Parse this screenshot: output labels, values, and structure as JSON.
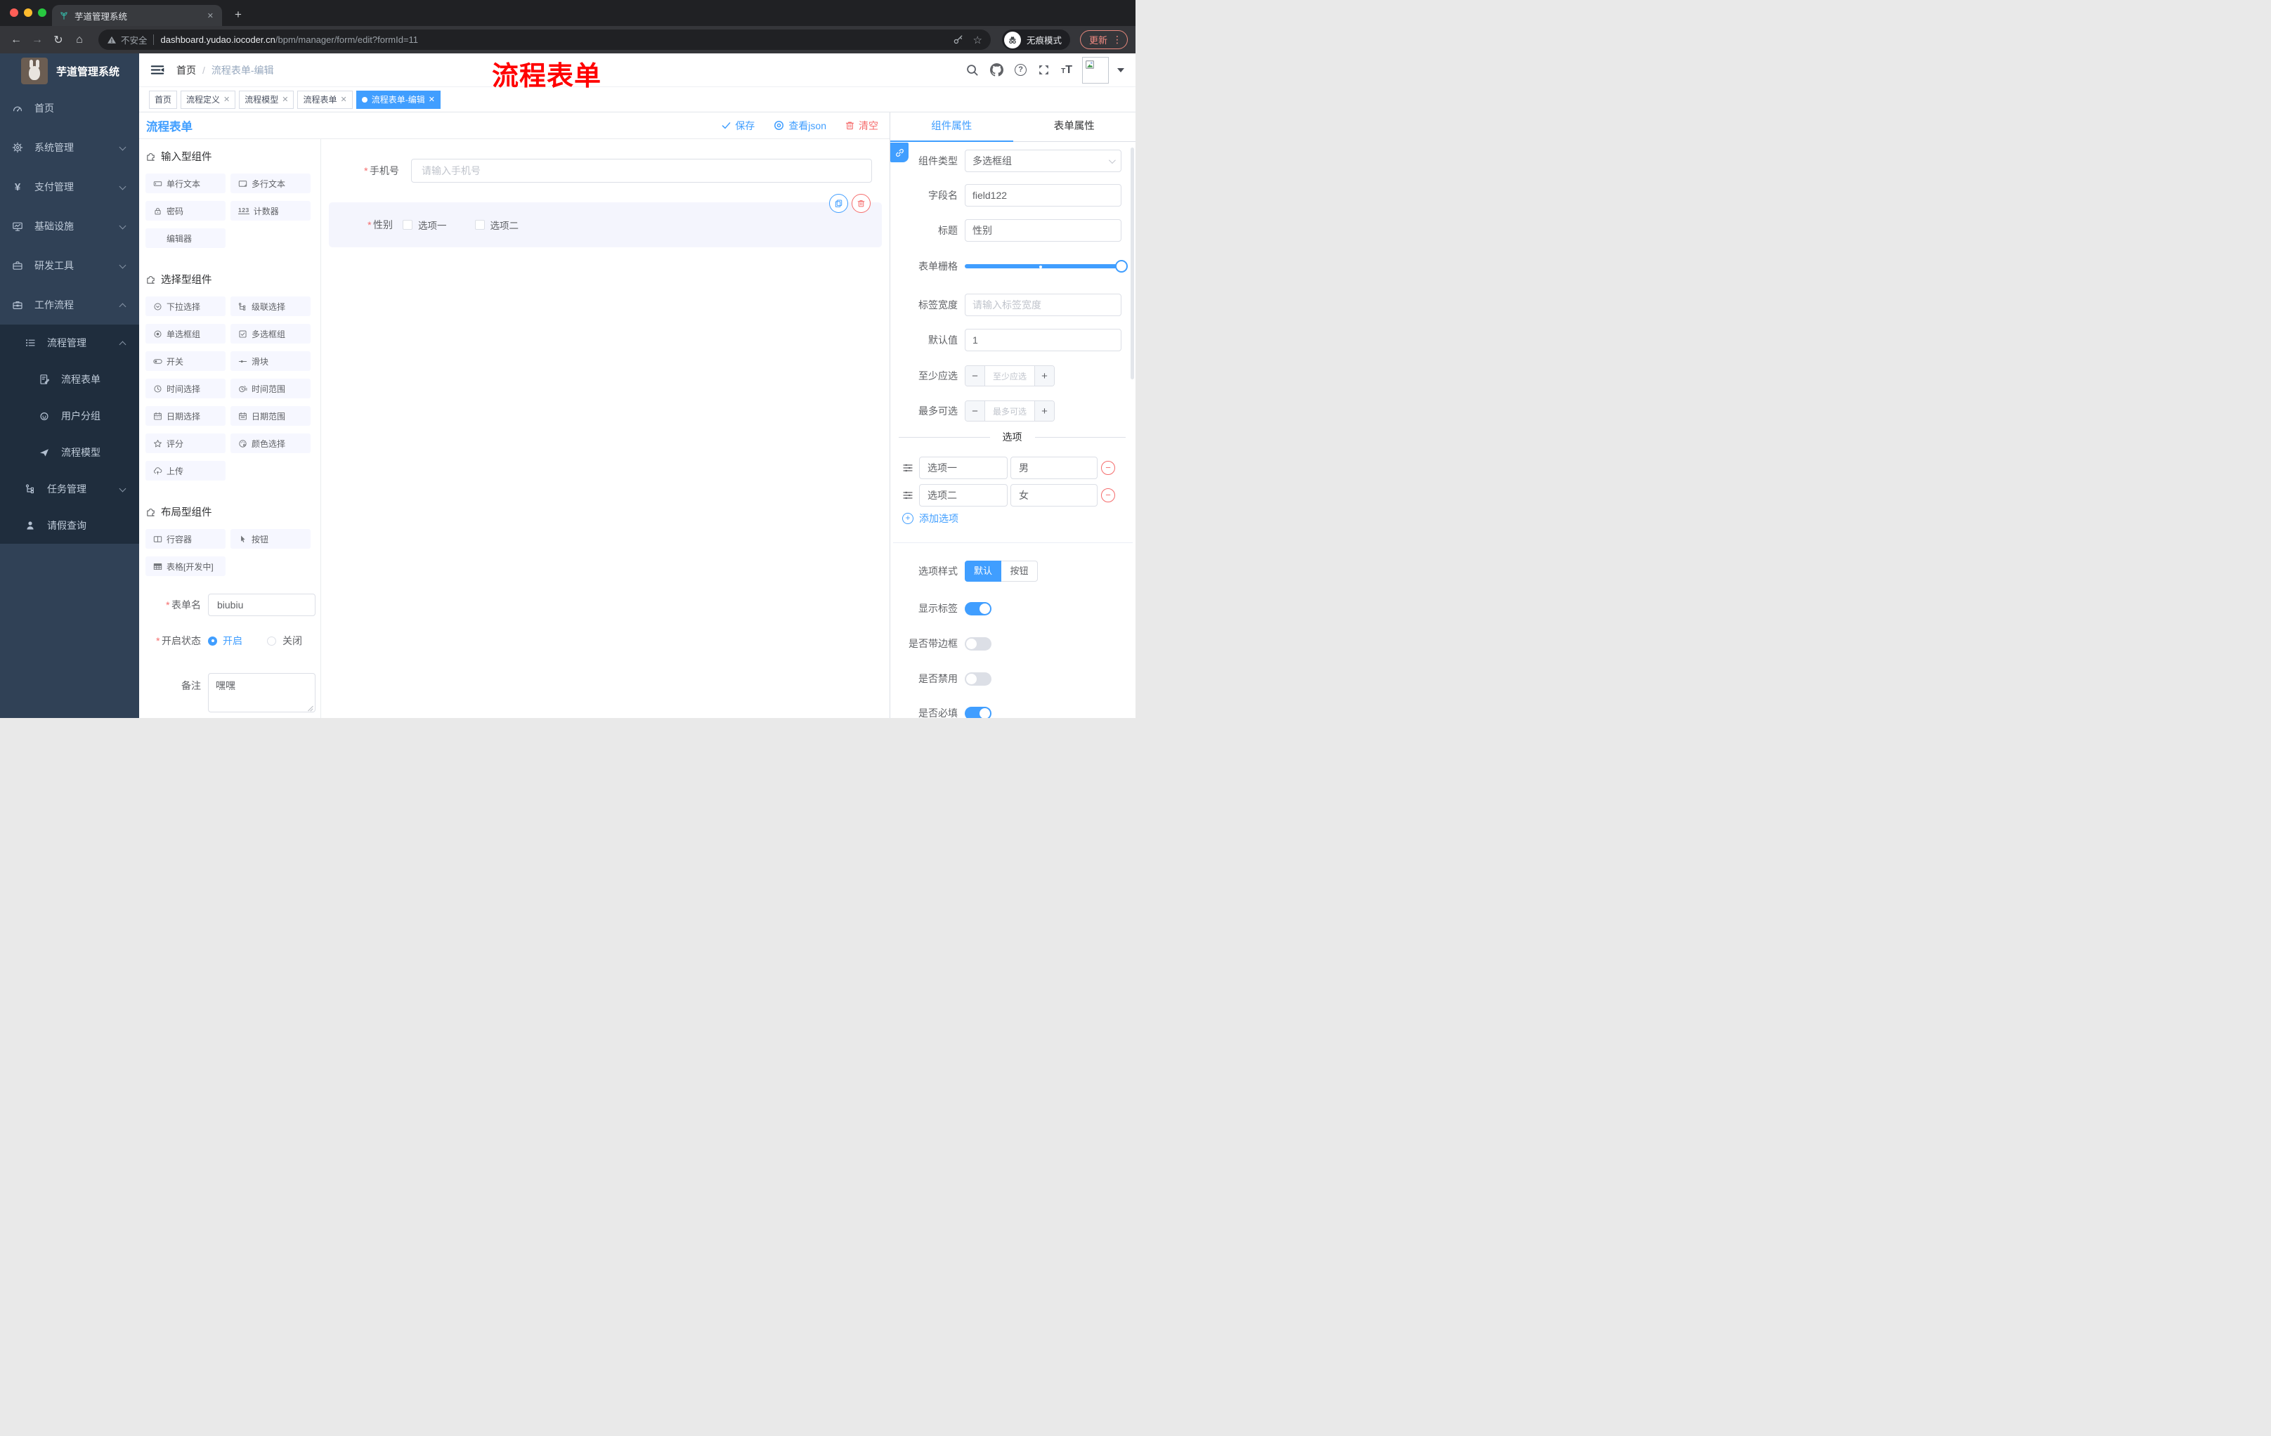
{
  "required_mark": "*",
  "browser": {
    "tab_title": "芋道管理系统",
    "glyphs": {
      "close": "✕",
      "new_tab": "+",
      "back": "←",
      "forward": "→",
      "reload": "↻",
      "home": "⌂",
      "star": "☆",
      "menu_dots": "⋮"
    },
    "address": {
      "not_secure": "不安全",
      "domain": "dashboard.yudao.iocoder.cn",
      "path": "/bpm/manager/form/edit?formId=11"
    },
    "incognito_label": "无痕模式",
    "update_label": "更新"
  },
  "sidebar": {
    "title": "芋道管理系统",
    "items": [
      {
        "label": "首页"
      },
      {
        "label": "系统管理"
      },
      {
        "label": "支付管理",
        "glyph": "¥"
      },
      {
        "label": "基础设施"
      },
      {
        "label": "研发工具"
      },
      {
        "label": "工作流程"
      },
      {
        "label": "流程管理"
      },
      {
        "label": "流程表单"
      },
      {
        "label": "用户分组"
      },
      {
        "label": "流程模型"
      },
      {
        "label": "任务管理"
      },
      {
        "label": "请假查询"
      }
    ]
  },
  "header": {
    "breadcrumb": {
      "home": "首页",
      "sep": "/",
      "current": "流程表单-编辑"
    },
    "help_glyph": "?",
    "font_big": "T",
    "font_small": "T"
  },
  "annotation": {
    "text": "流程表单",
    "color": "#ff0000"
  },
  "tags": [
    {
      "label": "首页"
    },
    {
      "label": "流程定义"
    },
    {
      "label": "流程模型"
    },
    {
      "label": "流程表单"
    },
    {
      "label": "流程表单-编辑"
    }
  ],
  "tag_close_glyph": "✕",
  "designer": {
    "title": "流程表单",
    "save": "保存",
    "view_json": "查看json",
    "clear": "清空"
  },
  "palette": {
    "sections": [
      {
        "title": "输入型组件",
        "items": [
          {
            "label": "单行文本"
          },
          {
            "label": "多行文本"
          },
          {
            "label": "密码"
          },
          {
            "label": "计数器",
            "glyph": "123"
          },
          {
            "label": "编辑器"
          }
        ]
      },
      {
        "title": "选择型组件",
        "items": [
          {
            "label": "下拉选择"
          },
          {
            "label": "级联选择"
          },
          {
            "label": "单选框组"
          },
          {
            "label": "多选框组"
          },
          {
            "label": "开关"
          },
          {
            "label": "滑块"
          },
          {
            "label": "时间选择"
          },
          {
            "label": "时间范围"
          },
          {
            "label": "日期选择"
          },
          {
            "label": "日期范围"
          },
          {
            "label": "评分"
          },
          {
            "label": "颜色选择"
          },
          {
            "label": "上传"
          }
        ]
      },
      {
        "title": "布局型组件",
        "items": [
          {
            "label": "行容器"
          },
          {
            "label": "按钮"
          },
          {
            "label": "表格[开发中]"
          }
        ]
      }
    ]
  },
  "left_form": {
    "name_label": "表单名",
    "name_value": "biubiu",
    "status_label": "开启状态",
    "status_on": "开启",
    "status_off": "关闭",
    "remark_label": "备注",
    "remark_value": "嘿嘿"
  },
  "canvas": {
    "phone_label": "手机号",
    "phone_placeholder": "请输入手机号",
    "gender_label": "性别",
    "gender_options": [
      {
        "label": "选项一"
      },
      {
        "label": "选项二"
      }
    ]
  },
  "inspector": {
    "tab_component": "组件属性",
    "tab_form": "表单属性",
    "type_label": "组件类型",
    "type_value": "多选框组",
    "name_label": "字段名",
    "name_value": "field122",
    "title_label": "标题",
    "title_value": "性别",
    "grid_label": "表单栅格",
    "label_width_label": "标签宽度",
    "label_width_placeholder": "请输入标签宽度",
    "default_label": "默认值",
    "default_value": "1",
    "min_label": "至少应选",
    "min_placeholder": "至少应选",
    "max_label": "最多可选",
    "max_placeholder": "最多可选",
    "minus_glyph": "−",
    "plus_glyph": "+",
    "options_title": "选项",
    "options": [
      {
        "label": "选项一",
        "value": "男"
      },
      {
        "label": "选项二",
        "value": "女"
      }
    ],
    "add_option": "添加选项",
    "style_label": "选项样式",
    "style_default": "默认",
    "style_button": "按钮",
    "toggle_show_label": "显示标签",
    "toggle_border": "是否带边框",
    "toggle_disabled": "是否禁用",
    "toggle_required": "是否必填"
  },
  "colors": {
    "accent": "#409eff",
    "danger": "#f56c6c",
    "sidebar_bg": "#304156",
    "submenu_bg": "#1f2d3d",
    "traffic": [
      "#ff5f57",
      "#febc2e",
      "#28c840"
    ]
  }
}
